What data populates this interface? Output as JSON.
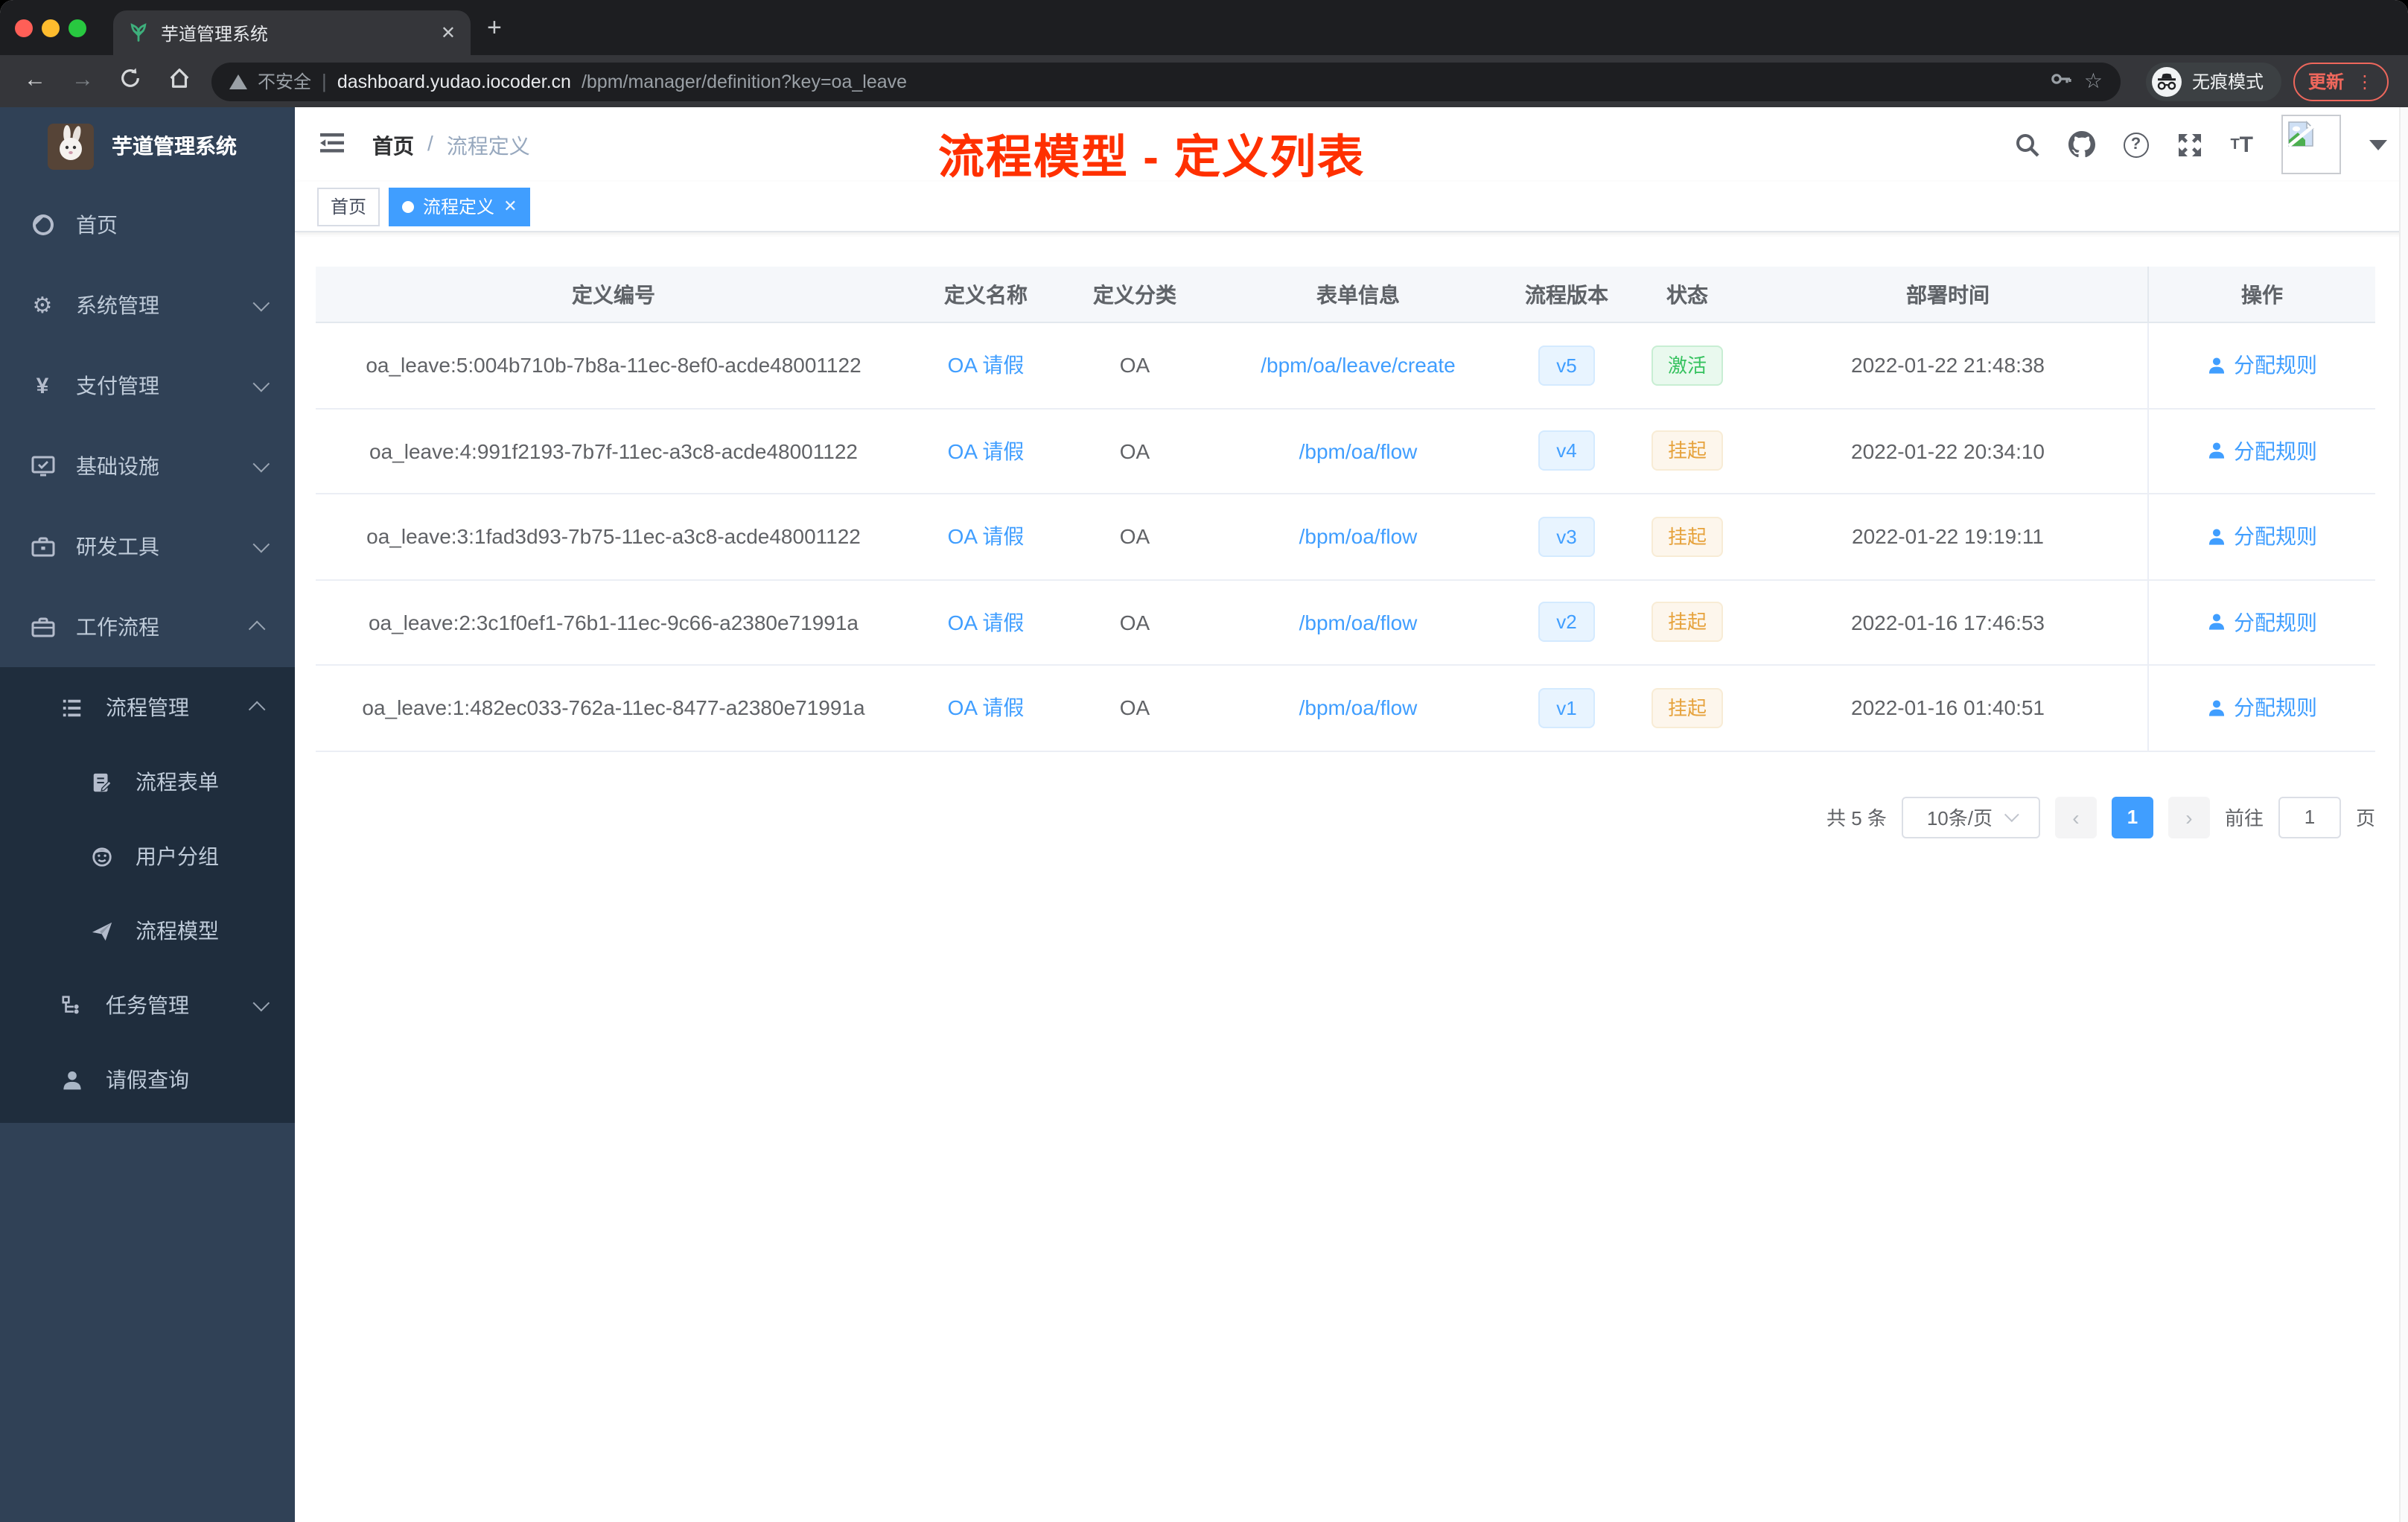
{
  "colors": {
    "accent": "#409eff",
    "annotation_red": "#ff3000",
    "success_green": "#36c25f",
    "warning_orange": "#e6a23c",
    "sidebar_bg": "#304156",
    "submenu_bg": "#1f2d3d"
  },
  "browser": {
    "tab_title": "芋道管理系统",
    "new_tab": "+",
    "close_tab": "✕",
    "security_label": "不安全",
    "url_host": "dashboard.yudao.iocoder.cn",
    "url_path": "/bpm/manager/definition?key=oa_leave",
    "incognito_label": "无痕模式",
    "update_label": "更新"
  },
  "sidebar": {
    "app_title": "芋道管理系统",
    "menu": [
      {
        "label": "首页",
        "icon": "dashboard-icon"
      },
      {
        "label": "系统管理",
        "icon": "gear-icon",
        "chevron": "down"
      },
      {
        "label": "支付管理",
        "icon": "yen-icon",
        "chevron": "down"
      },
      {
        "label": "基础设施",
        "icon": "monitor-icon",
        "chevron": "down"
      },
      {
        "label": "研发工具",
        "icon": "toolbox-icon",
        "chevron": "down"
      },
      {
        "label": "工作流程",
        "icon": "briefcase-icon",
        "chevron": "up"
      }
    ],
    "submenu": [
      {
        "label": "流程管理",
        "icon": "tree-list-icon",
        "chevron": "up"
      },
      {
        "label": "流程表单",
        "icon": "form-edit-icon"
      },
      {
        "label": "用户分组",
        "icon": "people-icon"
      },
      {
        "label": "流程模型",
        "icon": "paper-plane-icon"
      },
      {
        "label": "任务管理",
        "icon": "flow-icon",
        "chevron": "down"
      },
      {
        "label": "请假查询",
        "icon": "person-icon"
      }
    ]
  },
  "header": {
    "breadcrumb": {
      "home": "首页",
      "sep": "/",
      "current": "流程定义"
    },
    "annotation": "流程模型 - 定义列表"
  },
  "tags": [
    {
      "label": "首页",
      "active": false
    },
    {
      "label": "流程定义",
      "active": true,
      "close": "✕"
    }
  ],
  "table": {
    "columns": [
      "定义编号",
      "定义名称",
      "定义分类",
      "表单信息",
      "流程版本",
      "状态",
      "部署时间",
      "操作"
    ],
    "rows": [
      {
        "id": "oa_leave:5:004b710b-7b8a-11ec-8ef0-acde48001122",
        "name": "OA 请假",
        "category": "OA",
        "form": "/bpm/oa/leave/create",
        "version": "v5",
        "status": "激活",
        "status_type": "success",
        "time": "2022-01-22 21:48:38",
        "action": "分配规则"
      },
      {
        "id": "oa_leave:4:991f2193-7b7f-11ec-a3c8-acde48001122",
        "name": "OA 请假",
        "category": "OA",
        "form": "/bpm/oa/flow",
        "version": "v4",
        "status": "挂起",
        "status_type": "warning",
        "time": "2022-01-22 20:34:10",
        "action": "分配规则"
      },
      {
        "id": "oa_leave:3:1fad3d93-7b75-11ec-a3c8-acde48001122",
        "name": "OA 请假",
        "category": "OA",
        "form": "/bpm/oa/flow",
        "version": "v3",
        "status": "挂起",
        "status_type": "warning",
        "time": "2022-01-22 19:19:11",
        "action": "分配规则"
      },
      {
        "id": "oa_leave:2:3c1f0ef1-76b1-11ec-9c66-a2380e71991a",
        "name": "OA 请假",
        "category": "OA",
        "form": "/bpm/oa/flow",
        "version": "v2",
        "status": "挂起",
        "status_type": "warning",
        "time": "2022-01-16 17:46:53",
        "action": "分配规则"
      },
      {
        "id": "oa_leave:1:482ec033-762a-11ec-8477-a2380e71991a",
        "name": "OA 请假",
        "category": "OA",
        "form": "/bpm/oa/flow",
        "version": "v1",
        "status": "挂起",
        "status_type": "warning",
        "time": "2022-01-16 01:40:51",
        "action": "分配规则"
      }
    ]
  },
  "pagination": {
    "total": "共 5 条",
    "page_size": "10条/页",
    "prev": "‹",
    "next": "›",
    "current": "1",
    "goto_label": "前往",
    "goto_value": "1",
    "unit_label": "页"
  }
}
